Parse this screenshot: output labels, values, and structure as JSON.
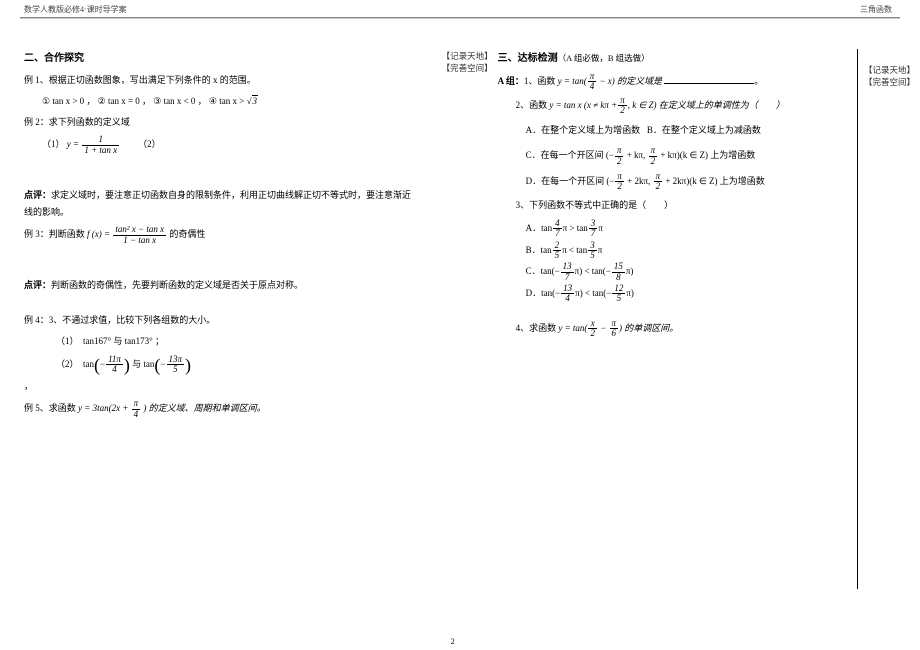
{
  "header": {
    "left": "数学人教版必修4·课时导学案",
    "right": "三角函数"
  },
  "annot": {
    "record": "【记录天地】",
    "improve": "【完善空间】"
  },
  "left": {
    "sec2_title": "二、合作探究",
    "ex1_intro": "例 1、根据正切函数图象，写出满足下列条件的 x 的范围。",
    "ex1_c1": "① tan x > 0 ，",
    "ex1_c2": "② tan x = 0 ，",
    "ex1_c3": "③ tan x < 0 ，",
    "ex1_c4_pre": "④ tan x > ",
    "ex1_c4_rad": "3",
    "ex2_intro": "例 2：求下列函数的定义域",
    "ex2_1_pre": "（1）",
    "ex2_1_y": "y =",
    "ex2_1_num": "1",
    "ex2_1_den": "1 + tan x",
    "ex2_1_post": "（2）",
    "note1a": "点评：",
    "note1b": "求定义域时，要注意正切函数自身的限制条件，利用正切曲线解正切不等式时，要注意渐近线的影响。",
    "ex3_pre": "例 3：判断函数",
    "ex3_f": "f (x) =",
    "ex3_num": "tan² x − tan x",
    "ex3_den": "1 − tan x",
    "ex3_post": "的奇偶性",
    "note2a": "点评：",
    "note2b": "判断函数的奇偶性，先要判断函数的定义域是否关于原点对称。",
    "ex4_intro": "例 4：3、不通过求值，比较下列各组数的大小。",
    "ex4_1": "（1）　tan167° 与 tan173° ；",
    "ex4_2_pre": "（2）　tan",
    "ex4_2_n1": "11π",
    "ex4_2_d1": "4",
    "ex4_2_mid": "与 tan",
    "ex4_2_n2": "13π",
    "ex4_2_d2": "5",
    "ex5_pre": "例 5、求函数",
    "ex5_y": "y = 3tan(2x +",
    "ex5_num": "π",
    "ex5_den": "4",
    "ex5_post": ") 的定义域、周期和单调区间。"
  },
  "right": {
    "sec3_title": "三、达标检测",
    "sec3_sub": "（A 组必做，B 组选做）",
    "A_label": "A 组：",
    "q1_pre": "1、函数",
    "q1_y": "y = tan(",
    "q1_num": "π",
    "q1_den": "4",
    "q1_post": " − x) 的定义域是",
    "q1_end": "。",
    "q2_pre": "2、函数",
    "q2_y": "y = tan x (x ≠ kπ +",
    "q2_num": "π",
    "q2_den": "2",
    "q2_post": ", k ∈ Z) 在定义域上的单调性为（　　）",
    "q2_A": "A．在整个定义域上为增函数",
    "q2_B": "B．在整个定义域上为减函数",
    "q2_C_pre": "C．在每一个开区间 (−",
    "q2_D_pre": "D．在每一个开区间 (−",
    "q2_C_post": ") 上为增函数",
    "q2_D_post": ") 上为增函数",
    "pi": "π",
    "two": "2",
    "kpi": " + kπ, ",
    "kpi2": " + kπ)(k ∈ Z",
    "twokpi": " + 2kπ, ",
    "twokpi2": " + 2kπ)(k ∈ Z",
    "q3_pre": "3、下列函数不等式中正确的是（　　）",
    "q3_A_pre": "A．tan",
    "q3_A_n1": "4",
    "q3_A_d1": "7",
    "q3_A_mid": "π > tan",
    "q3_A_n2": "3",
    "q3_A_d2": "7",
    "q3_A_end": "π",
    "q3_B_pre": "B．tan",
    "q3_B_n1": "2",
    "q3_B_d1": "5",
    "q3_B_mid": "π < tan",
    "q3_B_n2": "3",
    "q3_B_d2": "5",
    "q3_B_end": "π",
    "q3_C_pre": "C．tan(−",
    "q3_C_n1": "13",
    "q3_C_d1": "7",
    "q3_C_mid": "π) < tan(−",
    "q3_C_n2": "15",
    "q3_C_d2": "8",
    "q3_C_end": "π)",
    "q3_D_pre": "D．tan(−",
    "q3_D_n1": "13",
    "q3_D_d1": "4",
    "q3_D_mid": "π) < tan(−",
    "q3_D_n2": "12",
    "q3_D_d2": "5",
    "q3_D_end": "π)",
    "q4_pre": "4、求函数",
    "q4_y": "y = tan(",
    "q4_n1": "x",
    "q4_d1": "2",
    "q4_minus": " − ",
    "q4_n2": "π",
    "q4_d2": "6",
    "q4_post": ") 的单调区间。"
  },
  "pagenum": "2"
}
